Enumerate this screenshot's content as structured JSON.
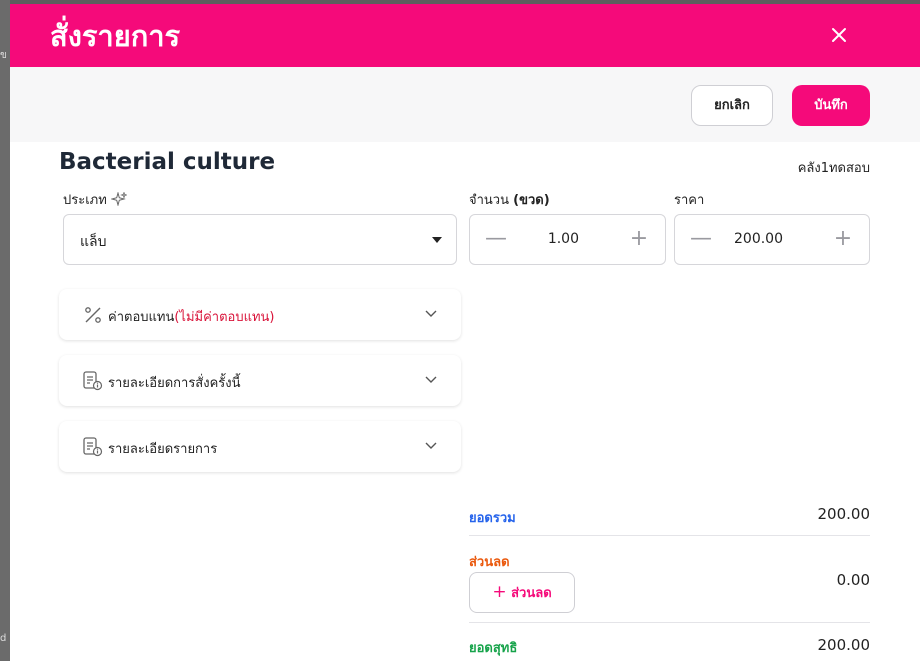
{
  "modal": {
    "title": "สั่งรายการ",
    "close_icon": "close-icon"
  },
  "actions": {
    "cancel_label": "ยกเลิก",
    "save_label": "บันทึก"
  },
  "item": {
    "name": "Bacterial culture",
    "store": "คลัง1ทดสอบ"
  },
  "type": {
    "label": "ประเภท",
    "icon": "sparkle-icon",
    "value": "แล็บ"
  },
  "quantity": {
    "label": "จำนวน",
    "unit": "(ขวด)",
    "value": "1.00"
  },
  "price": {
    "label": "ราคา",
    "value": "200.00"
  },
  "accordions": [
    {
      "icon": "percent-icon",
      "label": "ค่าตอบแทน",
      "note": "(ไม่มีค่าตอบแทน)"
    },
    {
      "icon": "document-info-icon",
      "label": "รายละเอียดการสั่งครั้งนี้"
    },
    {
      "icon": "document-info-icon",
      "label": "รายละเอียดรายการ"
    }
  ],
  "summary": {
    "total_label": "ยอดรวม",
    "total_value": "200.00",
    "discount_label": "ส่วนลด",
    "discount_button": "ส่วนลด",
    "discount_value": "0.00",
    "net_label": "ยอดสุทธิ",
    "net_value": "200.00"
  },
  "colors": {
    "brand": "#f50a7a",
    "total": "#2563eb",
    "discount": "#ea580c",
    "net": "#16a34a",
    "note": "#d9143a"
  }
}
